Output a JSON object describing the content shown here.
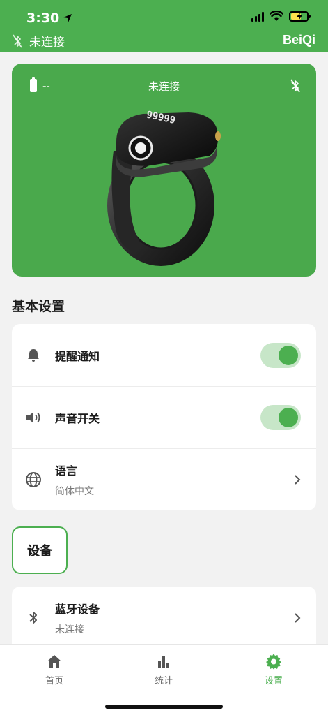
{
  "status_bar": {
    "time": "3:30"
  },
  "header": {
    "connection_status": "未连接",
    "brand": "BeiQi"
  },
  "device_card": {
    "battery_text": "--",
    "status": "未连接",
    "ring_display": "99999"
  },
  "basic_settings": {
    "title": "基本设置",
    "items": [
      {
        "label": "提醒通知",
        "type": "toggle",
        "enabled": true,
        "icon": "bell-icon"
      },
      {
        "label": "声音开关",
        "type": "toggle",
        "enabled": true,
        "icon": "speaker-icon"
      },
      {
        "label": "语言",
        "value": "简体中文",
        "type": "link",
        "icon": "globe-icon"
      }
    ]
  },
  "device_section": {
    "title": "设备",
    "items": [
      {
        "label": "蓝牙设备",
        "value": "未连接",
        "type": "link",
        "icon": "bluetooth-icon"
      }
    ]
  },
  "tabbar": {
    "tabs": [
      {
        "label": "首页",
        "icon": "home-icon",
        "active": false
      },
      {
        "label": "统计",
        "icon": "chart-icon",
        "active": false
      },
      {
        "label": "设置",
        "icon": "gear-icon",
        "active": true
      }
    ]
  },
  "colors": {
    "accent": "#4caf50",
    "card": "#4aa94c",
    "toggle_track": "#c7e6c8",
    "background": "#f2f2f2"
  }
}
